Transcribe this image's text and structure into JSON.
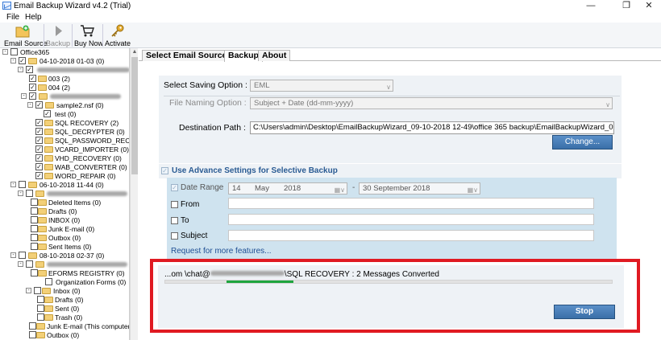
{
  "window": {
    "title": "Email Backup Wizard v4.2 (Trial)"
  },
  "menu": [
    "File",
    "Help"
  ],
  "toolbar": {
    "email_source": "Email Source",
    "backup": "Backup",
    "buy_now": "Buy Now",
    "activate": "Activate"
  },
  "tree": {
    "root": "Office365",
    "n1": "04-10-2018 01-03 (0)",
    "n1_ab": "003 (2)",
    "n1_ac": "004 (2)",
    "n1_sample": "sample2.nsf (0)",
    "n1_test": "test (0)",
    "n1_sql_recovery": "SQL RECOVERY (2)",
    "n1_sql_decrypter": "SQL_DECRYPTER (0)",
    "n1_sql_password": "SQL_PASSWORD_RECC",
    "n1_vcard": "VCARD_IMPORTER (0)",
    "n1_vhd": "VHD_RECOVERY (0)",
    "n1_wab": "WAB_CONVERTER (0)",
    "n1_word": "WORD_REPAIR (0)",
    "n2": "06-10-2018 11-44 (0)",
    "n2_deleted": "Deleted Items (0)",
    "n2_drafts": "Drafts (0)",
    "n2_inbox": "INBOX (0)",
    "n2_junk": "Junk E-mail (0)",
    "n2_outbox": "Outbox (0)",
    "n2_sent": "Sent Items (0)",
    "n3": "08-10-2018 02-37 (0)",
    "n3_eforms": "EFORMS REGISTRY (0)",
    "n3_orgforms": "Organization Forms (0)",
    "n3_inbox": "Inbox (0)",
    "n3_drafts": "Drafts (0)",
    "n3_sent": "Sent (0)",
    "n3_trash": "Trash (0)",
    "n3_junk": "Junk E-mail (This computer o",
    "n3_outbox": "Outbox (0)"
  },
  "tabs": [
    "Select Email Source",
    "Backup",
    "About"
  ],
  "form": {
    "saving_option_label": "Select Saving Option :",
    "saving_option_value": "EML",
    "naming_option_label": "File Naming Option :",
    "naming_option_value": "Subject + Date (dd-mm-yyyy)",
    "destination_label": "Destination Path :",
    "destination_value": "C:\\Users\\admin\\Desktop\\EmailBackupWizard_09-10-2018 12-49\\office 365 backup\\EmailBackupWizard_0",
    "change_button": "Change..."
  },
  "advance": {
    "title": "Use Advance Settings for Selective Backup",
    "date_range_label": "Date Range",
    "date_from_day": "14",
    "date_from_month": "May",
    "date_from_year": "2018",
    "date_dash": "-",
    "date_to": "30 September 2018",
    "from_label": "From",
    "to_label": "To",
    "subject_label": "Subject",
    "request_link": "Request for more features..."
  },
  "progress": {
    "status_prefix": "...om \\chat@",
    "status_suffix": "\\SQL RECOVERY : 2 Messages Converted",
    "value": 0.15,
    "stop_button": "Stop"
  }
}
